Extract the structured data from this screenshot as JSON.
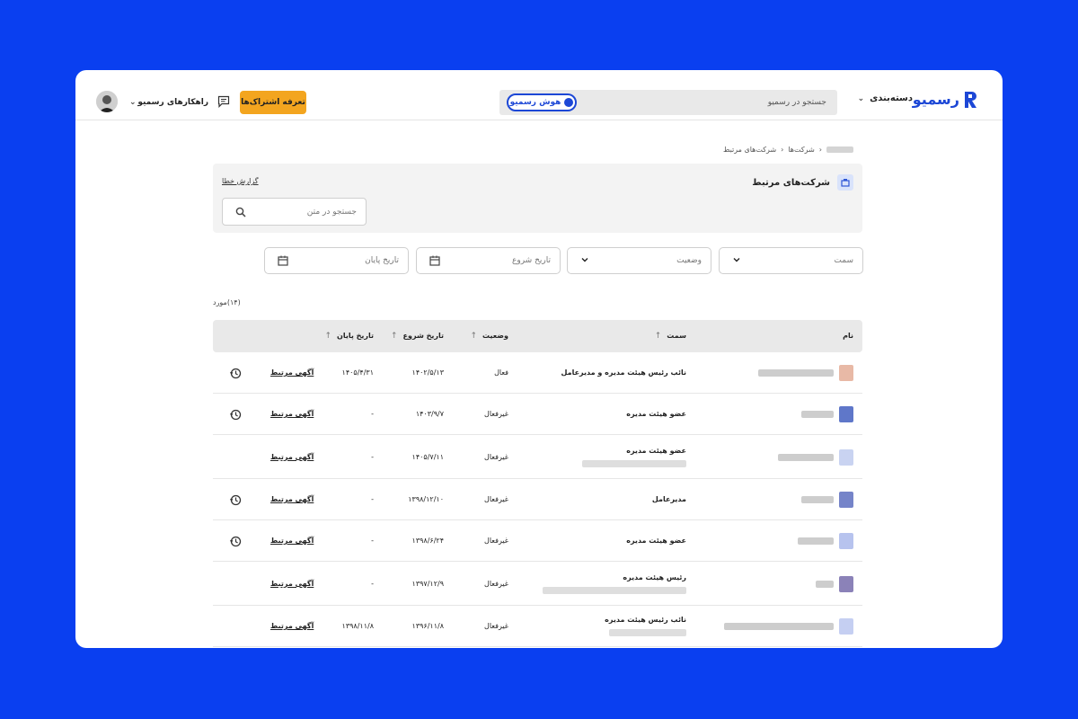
{
  "header": {
    "logo_text": "رسمیو",
    "category_menu": "دسته‌بندی",
    "search_placeholder": "جستجو در رسمیو",
    "ai_button": "هوش رسمیو",
    "plans_button": "تعرفه اشتراک‌ها",
    "solutions_menu": "راهکارهای رسمیو"
  },
  "breadcrumb": {
    "item1": "شرکت‌ها",
    "item2": "شرکت‌های مرتبط"
  },
  "panel": {
    "title": "شرکت‌های مرتبط",
    "report_link": "گزارش خطا",
    "text_search_placeholder": "جستجو در متن"
  },
  "filters": {
    "position": "سمت",
    "status": "وضعیت",
    "start_date": "تاریخ شروع",
    "end_date": "تاریخ پایان"
  },
  "result_count": "(۱۴)مورد",
  "table": {
    "columns": {
      "name": "نام",
      "position": "سمت",
      "status": "وضعیت",
      "start_date": "تاریخ شروع",
      "end_date": "تاریخ پایان"
    },
    "rows": [
      {
        "position": "نائب رئیس هیئت مدیره و مدیرعامل",
        "status": "فعال",
        "start_date": "۱۴۰۲/۵/۱۳",
        "end_date": "۱۴۰۵/۴/۳۱",
        "link": "آگهی مرتبط",
        "history": true
      },
      {
        "position": "عضو هیئت مدیره",
        "status": "غیرفعال",
        "start_date": "۱۴۰۳/۹/۷",
        "end_date": "-",
        "link": "آگهی مرتبط",
        "history": true
      },
      {
        "position": "عضو هیئت مدیره",
        "status": "غیرفعال",
        "start_date": "۱۴۰۵/۷/۱۱",
        "end_date": "-",
        "link": "آگهی مرتبط",
        "history": false
      },
      {
        "position": "مدیرعامل",
        "status": "غیرفعال",
        "start_date": "۱۳۹۸/۱۲/۱۰",
        "end_date": "-",
        "link": "آگهی مرتبط",
        "history": true
      },
      {
        "position": "عضو هیئت مدیره",
        "status": "غیرفعال",
        "start_date": "۱۳۹۸/۶/۲۴",
        "end_date": "-",
        "link": "آگهی مرتبط",
        "history": true
      },
      {
        "position": "رئیس هیئت مدیره",
        "status": "غیرفعال",
        "start_date": "۱۳۹۷/۱۲/۹",
        "end_date": "-",
        "link": "آگهی مرتبط",
        "history": false
      },
      {
        "position": "نائب رئیس هیئت مدیره",
        "status": "غیرفعال",
        "start_date": "۱۳۹۶/۱۱/۸",
        "end_date": "۱۳۹۸/۱۱/۸",
        "link": "آگهی مرتبط",
        "history": false
      }
    ]
  },
  "colors": {
    "background": "#0a3ff0",
    "brand": "#1c47d6",
    "accent": "#f3a51f"
  }
}
